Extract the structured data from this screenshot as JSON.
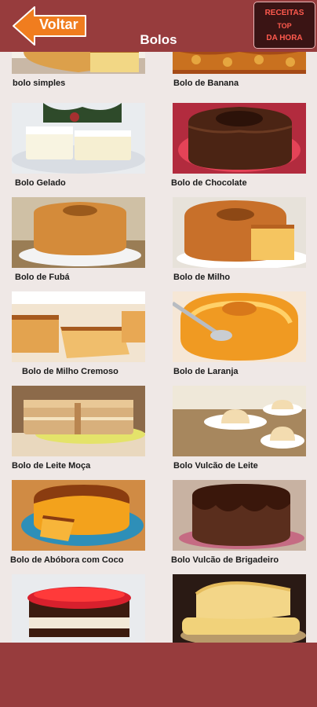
{
  "header": {
    "back_label": "Voltar",
    "title": "Bolos",
    "brand": [
      "RECEITAS",
      "TOP",
      "DA HORA"
    ]
  },
  "recipes": [
    "bolo  simples",
    "Bolo de Banana",
    "Bolo Gelado",
    "Bolo de Chocolate",
    "Bolo de Fubá",
    "Bolo de Milho",
    "Bolo de Milho Cremoso",
    "Bolo de Laranja",
    "Bolo de Leite Moça",
    "Bolo Vulcão de Leite",
    "Bolo de Abóbora com Coco",
    "Bolo Vulcão de Brigadeiro",
    "",
    ""
  ],
  "colors": {
    "bar": "#973c3d",
    "background": "#efe8e6",
    "back_arrow": "#f07d1f",
    "brand_text": "#ff5a4e"
  },
  "icons": {
    "back": "arrow-left-icon"
  }
}
